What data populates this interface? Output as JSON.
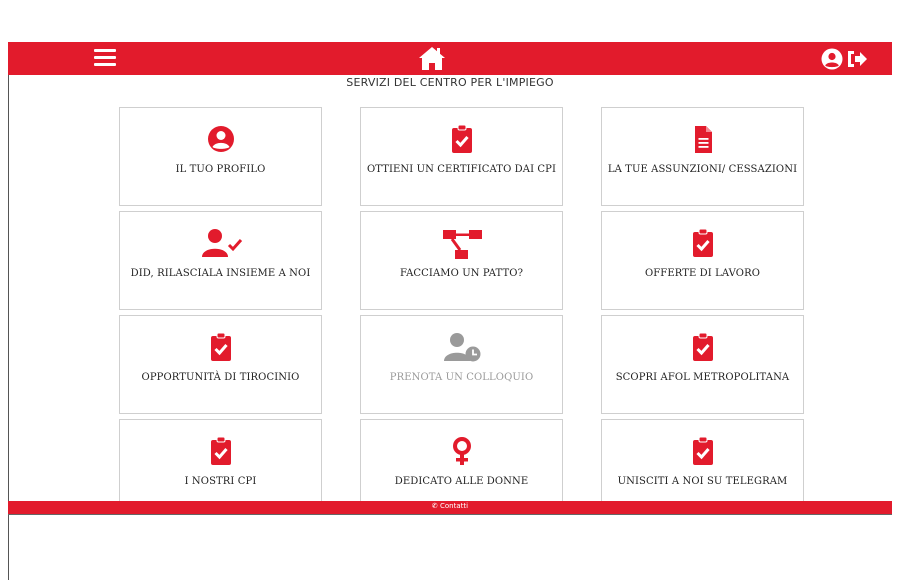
{
  "colors": {
    "accent": "#e21b2c",
    "disabled": "#9a9a9a"
  },
  "header": {
    "icons": [
      "menu-icon",
      "home-icon",
      "user-circle-icon",
      "logout-icon"
    ]
  },
  "page": {
    "subtitle": "SERVIZI DEL CENTRO PER L'IMPIEGO"
  },
  "cards": [
    {
      "label": "IL TUO PROFILO",
      "icon": "user-circle-icon"
    },
    {
      "label": "OTTIENI UN CERTIFICATO DAI CPI",
      "icon": "clipboard-check-icon"
    },
    {
      "label": "LA TUE ASSUNZIONI/ CESSAZIONI",
      "icon": "document-icon"
    },
    {
      "label": "DID, RILASCIALA INSIEME A NOI",
      "icon": "user-check-icon"
    },
    {
      "label": "FACCIAMO UN PATTO?",
      "icon": "sitemap-icon"
    },
    {
      "label": "OFFERTE DI LAVORO",
      "icon": "clipboard-check-icon"
    },
    {
      "label": "OPPORTUNITÀ DI TIROCINIO",
      "icon": "clipboard-check-icon"
    },
    {
      "label": "PRENOTA UN COLLOQUIO",
      "icon": "user-clock-icon",
      "disabled": true
    },
    {
      "label": "SCOPRI AFOL METROPOLITANA",
      "icon": "clipboard-check-icon"
    },
    {
      "label": "I NOSTRI CPI",
      "icon": "clipboard-check-icon"
    },
    {
      "label": "DEDICATO ALLE DONNE",
      "icon": "venus-icon"
    },
    {
      "label": "UNISCITI A NOI SU TELEGRAM",
      "icon": "clipboard-check-icon"
    }
  ],
  "footer": {
    "contact": "Contatti",
    "contact_icon": "phone-icon"
  }
}
